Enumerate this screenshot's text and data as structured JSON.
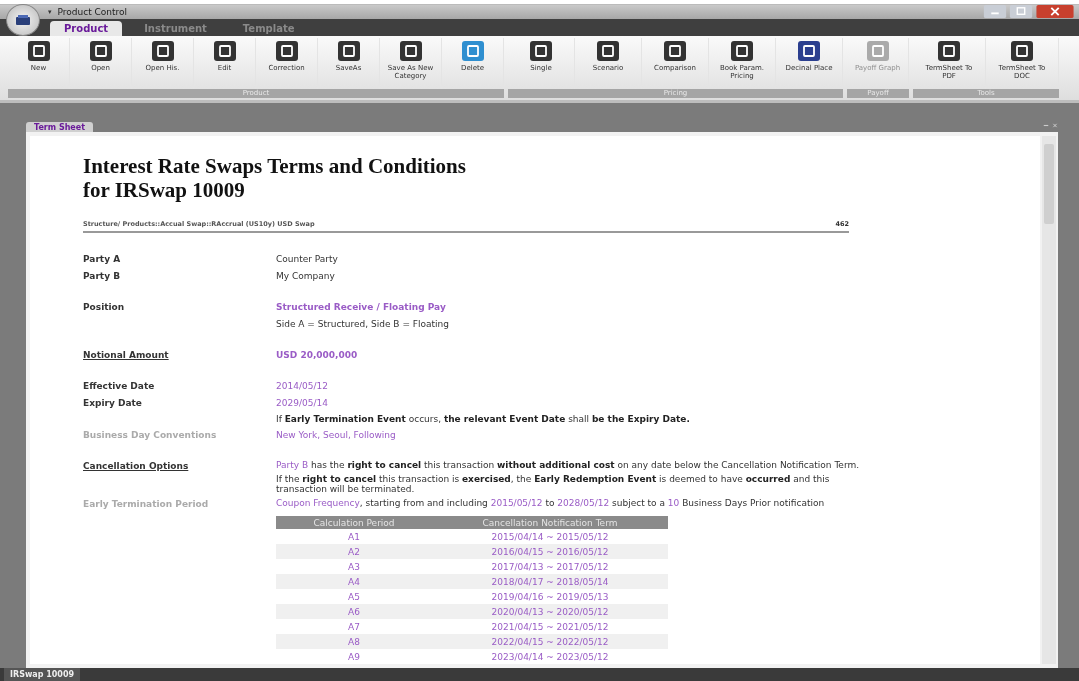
{
  "window": {
    "title": "Product Control",
    "quick_access": "▾"
  },
  "tabs": [
    {
      "label": "Product",
      "selected": true
    },
    {
      "label": "Instrument",
      "selected": false
    },
    {
      "label": "Template",
      "selected": false
    }
  ],
  "ribbon": [
    {
      "group": "Product",
      "buttons": [
        {
          "label": "New",
          "disabled": false
        },
        {
          "label": "Open",
          "disabled": false
        },
        {
          "label": "Open His.",
          "disabled": false
        },
        {
          "label": "Edit",
          "disabled": false
        },
        {
          "label": "Correction",
          "disabled": false
        },
        {
          "label": "SaveAs",
          "disabled": false
        },
        {
          "label": "Save As New Category",
          "disabled": false
        },
        {
          "label": "Delete",
          "disabled": false
        }
      ]
    },
    {
      "group": "Pricing",
      "buttons": [
        {
          "label": "Single",
          "disabled": false
        },
        {
          "label": "Scenario",
          "disabled": false
        },
        {
          "label": "Comparison",
          "disabled": false
        },
        {
          "label": "Book Param. Pricing",
          "disabled": false
        },
        {
          "label": "Decinal Place",
          "disabled": false
        }
      ]
    },
    {
      "group": "Payoff",
      "buttons": [
        {
          "label": "Payoff Graph",
          "disabled": true
        }
      ]
    },
    {
      "group": "Tools",
      "buttons": [
        {
          "label": "TermSheet To PDF",
          "disabled": false
        },
        {
          "label": "TermSheet To DOC",
          "disabled": false
        }
      ]
    }
  ],
  "document_tab": {
    "label": "Term Sheet"
  },
  "term_sheet": {
    "title": [
      "Interest Rate Swaps Terms and Conditions",
      "for IRSwap 10009"
    ],
    "breadcrumb": "Structure/ Products::Accual Swap::RAccrual (US10y) USD Swap",
    "page_number": "462",
    "sections": [
      [
        {
          "label": "Party A",
          "kind": "normal",
          "lines": [
            [
              {
                "text": "Counter Party",
                "kind": "plain"
              }
            ]
          ]
        },
        {
          "label": "Party B",
          "kind": "normal",
          "lines": [
            [
              {
                "text": "My Company",
                "kind": "plain"
              }
            ]
          ]
        }
      ],
      [
        {
          "label": "Position",
          "kind": "normal",
          "lines": [
            [
              {
                "text": "Structured Receive / Floating Pay",
                "kind": "accent-bold"
              }
            ],
            [
              {
                "text": "Side A = Structured, Side B = Floating",
                "kind": "plain"
              }
            ]
          ]
        }
      ],
      [
        {
          "label": "Notional Amount",
          "kind": "underlined",
          "lines": [
            [
              {
                "text": "USD 20,000,000",
                "kind": "accent-bold"
              }
            ]
          ]
        }
      ],
      [
        {
          "label": "Effective Date",
          "kind": "normal",
          "lines": [
            [
              {
                "text": "2014/05/12",
                "kind": "accent"
              }
            ]
          ]
        },
        {
          "label": "Expiry Date",
          "kind": "normal",
          "lines": [
            [
              {
                "text": "2029/05/14",
                "kind": "accent"
              }
            ],
            [
              {
                "text": "If ",
                "kind": "plain"
              },
              {
                "text": "Early Termination Event",
                "kind": "bold"
              },
              {
                "text": " occurs, ",
                "kind": "plain"
              },
              {
                "text": "the relevant Event Date",
                "kind": "bold"
              },
              {
                "text": " shall ",
                "kind": "plain"
              },
              {
                "text": "be the Expiry Date.",
                "kind": "bold"
              }
            ]
          ]
        },
        {
          "label": "Business Day Conventions",
          "kind": "muted",
          "lines": [
            [
              {
                "text": "New York, Seoul, Following",
                "kind": "accent"
              }
            ]
          ]
        }
      ],
      [
        {
          "label": "Cancellation Options",
          "kind": "underlined",
          "lines": [
            [
              {
                "text": "Party B",
                "kind": "accent"
              },
              {
                "text": " has the ",
                "kind": "plain"
              },
              {
                "text": "right to cancel",
                "kind": "bold"
              },
              {
                "text": " this transaction ",
                "kind": "plain"
              },
              {
                "text": "without additional cost",
                "kind": "bold"
              },
              {
                "text": " on any date below the Cancellation Notification Term.",
                "kind": "plain"
              }
            ],
            [
              {
                "text": "If the ",
                "kind": "plain"
              },
              {
                "text": "right to cancel",
                "kind": "bold"
              },
              {
                "text": " this transaction is ",
                "kind": "plain"
              },
              {
                "text": "exercised",
                "kind": "bold"
              },
              {
                "text": ", the ",
                "kind": "plain"
              },
              {
                "text": "Early Redemption Event",
                "kind": "bold"
              },
              {
                "text": " is deemed to have ",
                "kind": "plain"
              },
              {
                "text": "occurred",
                "kind": "bold"
              },
              {
                "text": " and this transaction will be terminated.",
                "kind": "plain"
              }
            ]
          ]
        },
        {
          "label": "Early Termination Period",
          "kind": "muted",
          "lines": [
            [
              {
                "text": "Coupon Frequency",
                "kind": "accent"
              },
              {
                "text": ", starting from and including ",
                "kind": "plain"
              },
              {
                "text": "2015/05/12",
                "kind": "accent"
              },
              {
                "text": " to ",
                "kind": "plain"
              },
              {
                "text": "2028/05/12",
                "kind": "accent"
              },
              {
                "text": " subject to a ",
                "kind": "plain"
              },
              {
                "text": "10",
                "kind": "accent"
              },
              {
                "text": " Business Days Prior notification",
                "kind": "plain"
              }
            ]
          ]
        }
      ]
    ],
    "table": {
      "columns": [
        "Calculation Period",
        "Cancellation Notification Term"
      ],
      "rows": [
        [
          "A1",
          "2015/04/14 ~ 2015/05/12"
        ],
        [
          "A2",
          "2016/04/15 ~ 2016/05/12"
        ],
        [
          "A3",
          "2017/04/13 ~ 2017/05/12"
        ],
        [
          "A4",
          "2018/04/17 ~ 2018/05/14"
        ],
        [
          "A5",
          "2019/04/16 ~ 2019/05/13"
        ],
        [
          "A6",
          "2020/04/13 ~ 2020/05/12"
        ],
        [
          "A7",
          "2021/04/15 ~ 2021/05/12"
        ],
        [
          "A8",
          "2022/04/15 ~ 2022/05/12"
        ],
        [
          "A9",
          "2023/04/14 ~ 2023/05/12"
        ]
      ]
    }
  },
  "status_bar": {
    "tabs": [
      {
        "label": "IRSwap 10009"
      }
    ]
  }
}
